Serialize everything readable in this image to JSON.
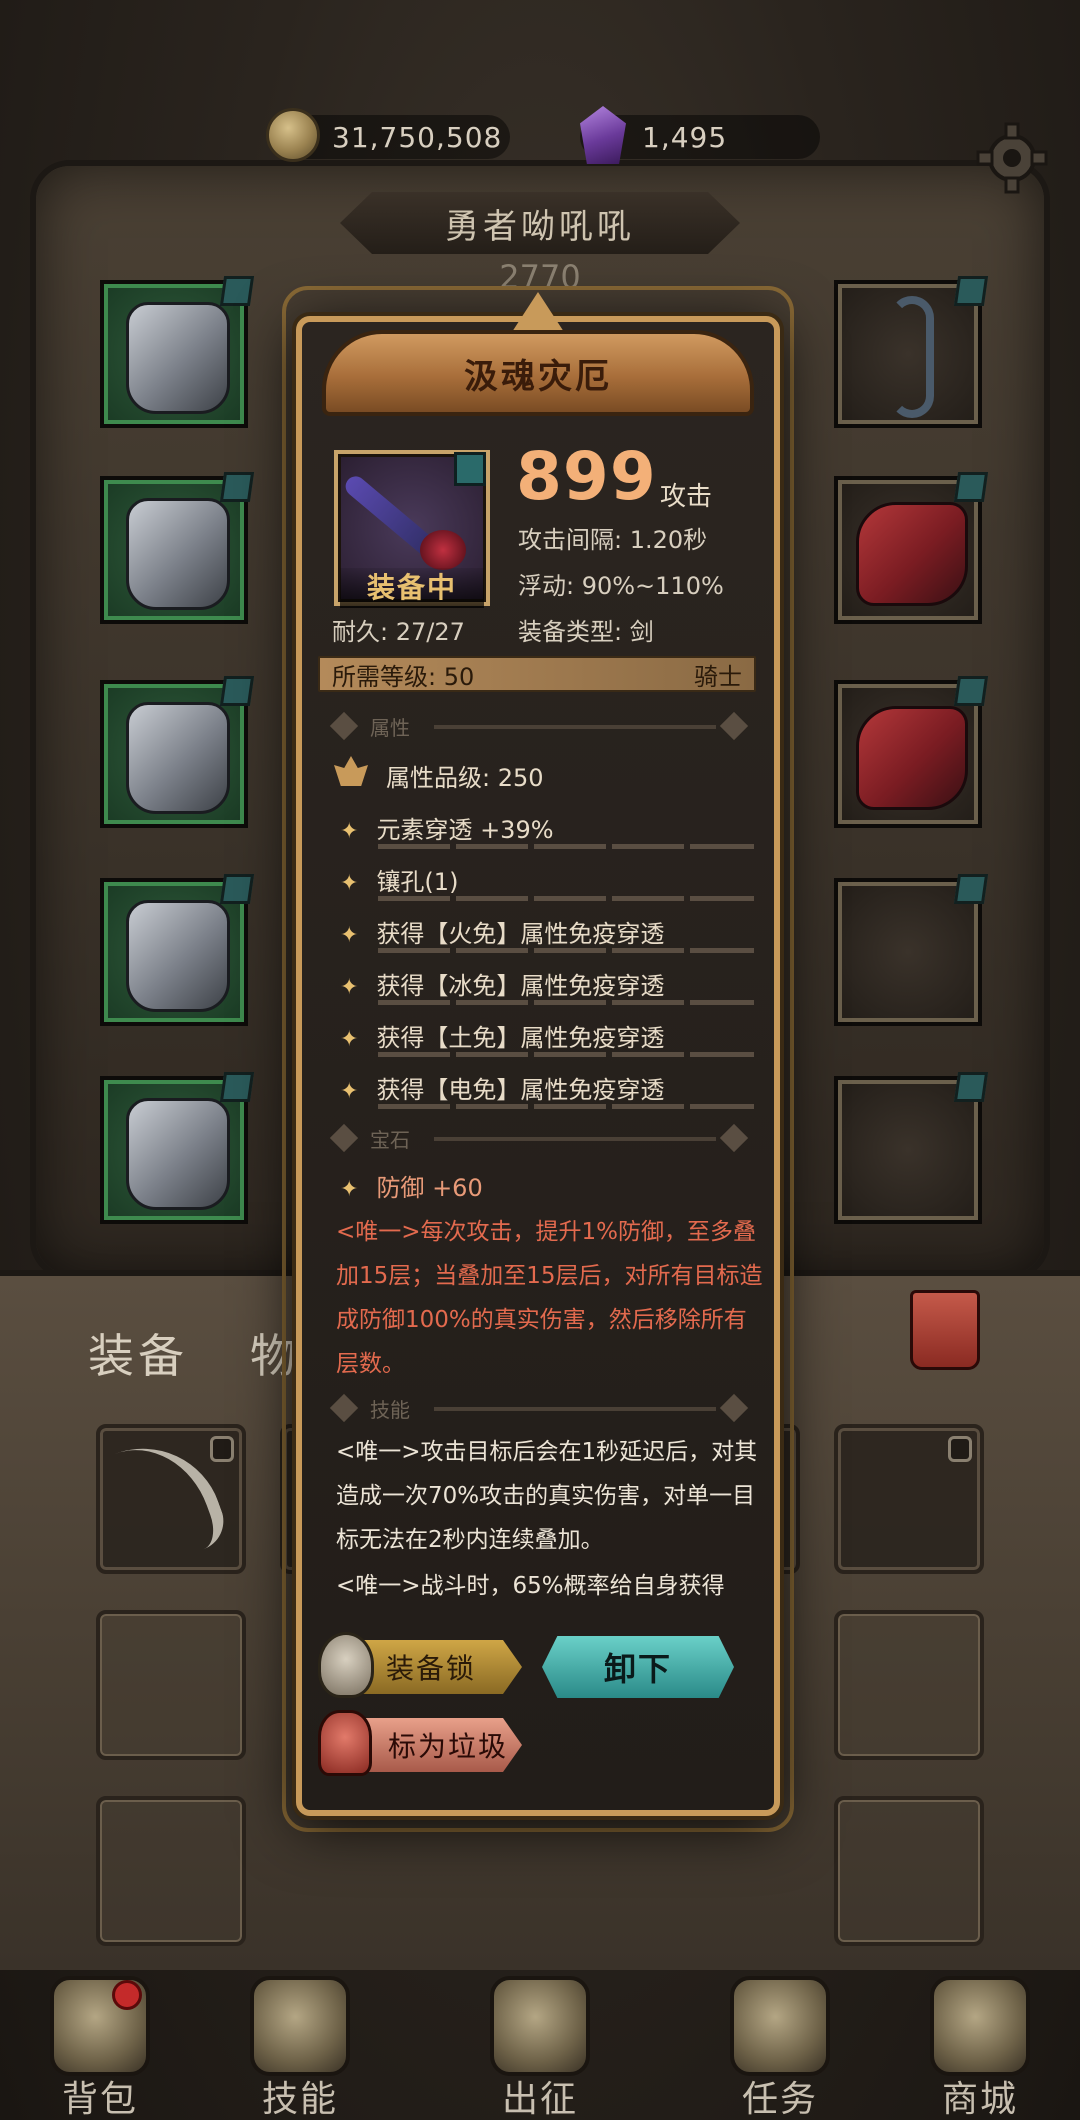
{
  "currency": {
    "coins": "31,750,508",
    "gems": "1,495"
  },
  "player": {
    "name": "勇者呦吼吼",
    "level": "2770"
  },
  "bag_tabs": {
    "equipment": "装备",
    "items": "物"
  },
  "nav": [
    "背包",
    "技能",
    "出征",
    "任务",
    "商城"
  ],
  "item": {
    "title": "汲魂灾厄",
    "equipped_label": "装备中",
    "durability": "耐久: 27/27",
    "attack_value": "899",
    "attack_label": "攻击",
    "attack_interval": "攻击间隔: 1.20秒",
    "float": "浮动: 90%~110%",
    "equip_type": "装备类型: 剑",
    "required_level": "所需等级: 50",
    "class": "骑士",
    "section_attributes": "属性",
    "attribute_grade": "属性品级: 250",
    "attributes": [
      "元素穿透 +39%",
      "镶孔(1)",
      "获得【火免】属性免疫穿透",
      "获得【冰免】属性免疫穿透",
      "获得【土免】属性免疫穿透",
      "获得【电免】属性免疫穿透"
    ],
    "section_gem": "宝石",
    "gem": "防御 +60",
    "unique_effect": "<唯一>每次攻击，提升1%防御，至多叠加15层；当叠加至15层后，对所有目标造成防御100%的真实伤害，然后移除所有层数。",
    "section_skills": "技能",
    "skill_1": "<唯一>攻击目标后会在1秒延迟后，对其造成一次70%攻击的真实伤害，对单一目标无法在2秒内连续叠加。",
    "skill_2": "<唯一>战斗时，65%概率给自身获得"
  },
  "buttons": {
    "lock": "装备锁",
    "unequip": "卸下",
    "junk": "标为垃圾"
  },
  "colors": {
    "accent_gold": "#c89a5a",
    "attack_orange": "#f3b078",
    "unique_red": "#e36a4e",
    "unequip_teal": "#3aa8a4"
  }
}
